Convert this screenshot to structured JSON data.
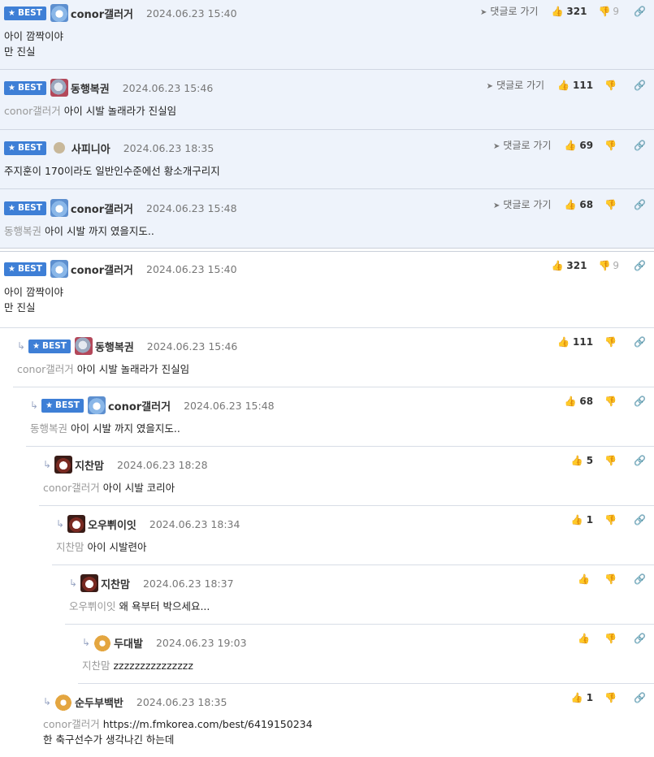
{
  "best_badge": "BEST",
  "goto_label": "댓글로 가기",
  "best": [
    {
      "nick": "conor갤러거",
      "date": "2024.06.23 15:40",
      "lines": [
        "아이 깜짝이야",
        "만 진실"
      ],
      "up": "321",
      "down": "9",
      "mention": ""
    },
    {
      "nick": "동행복권",
      "date": "2024.06.23 15:46",
      "mention": "conor갤러거",
      "lines": [
        "아이 시발 놀래라가 진실임"
      ],
      "up": "111",
      "down": ""
    },
    {
      "nick": "사피니아",
      "date": "2024.06.23 18:35",
      "mention": "",
      "lines": [
        "주지훈이 170이라도 일반인수준에선 황소개구리지"
      ],
      "up": "69",
      "down": ""
    },
    {
      "nick": "conor갤러거",
      "date": "2024.06.23 15:48",
      "mention": "동행복권",
      "lines": [
        "아이 시발 까지 였을지도.."
      ],
      "up": "68",
      "down": ""
    }
  ],
  "thread": [
    {
      "nick": "conor갤러거",
      "date": "2024.06.23 15:40",
      "mention": "",
      "lines": [
        "아이 깜짝이야",
        "만 진실"
      ],
      "up": "321",
      "down": "9"
    },
    {
      "nick": "동행복권",
      "date": "2024.06.23 15:46",
      "mention": "conor갤러거",
      "lines": [
        "아이 시발 놀래라가 진실임"
      ],
      "up": "111",
      "down": ""
    },
    {
      "nick": "conor갤러거",
      "date": "2024.06.23 15:48",
      "mention": "동행복권",
      "lines": [
        "아이 시발 까지 였을지도.."
      ],
      "up": "68",
      "down": ""
    },
    {
      "nick": "지찬맘",
      "date": "2024.06.23 18:28",
      "mention": "conor갤러거",
      "lines": [
        "아이 시발 코리아"
      ],
      "up": "5",
      "down": ""
    },
    {
      "nick": "오우쀠이잇",
      "date": "2024.06.23 18:34",
      "mention": "지찬맘",
      "lines": [
        "아이 시발련아"
      ],
      "up": "1",
      "down": ""
    },
    {
      "nick": "지찬맘",
      "date": "2024.06.23 18:37",
      "mention": "오우쀠이잇",
      "lines": [
        "왜 욕부터 박으세요..."
      ],
      "up": "",
      "down": ""
    },
    {
      "nick": "두대발",
      "date": "2024.06.23 19:03",
      "mention": "지찬맘",
      "lines": [
        "zzzzzzzzzzzzzzz"
      ],
      "up": "",
      "down": ""
    },
    {
      "nick": "순두부백반",
      "date": "2024.06.23 18:35",
      "mention": "conor갤러거",
      "lines": [
        "https://m.fmkorea.com/best/6419150234",
        "한 축구선수가 생각나긴 하는데"
      ],
      "up": "1",
      "down": ""
    }
  ],
  "icons": {
    "star": "star-icon",
    "thumb_up": "thumb-up-icon",
    "thumb_down": "thumb-down-icon",
    "link": "link-icon",
    "reply": "reply-arrow-icon",
    "goto": "arrow-icon"
  },
  "colors": {
    "badge": "#3e7fd6",
    "best_bg": "#eef3fb"
  }
}
